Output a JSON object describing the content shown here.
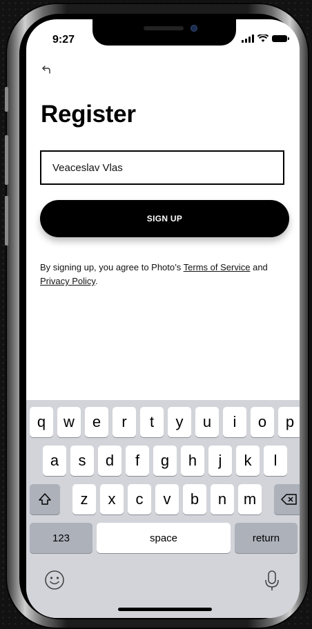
{
  "status_bar": {
    "time": "9:27"
  },
  "page": {
    "title": "Register"
  },
  "form": {
    "name_value": "Veaceslav Vlas",
    "signup_label": "SIGN UP",
    "terms_prefix": "By signing up, you agree to Photo’s ",
    "terms_link": "Terms of Service",
    "terms_middle": " and ",
    "privacy_link": "Privacy Policy",
    "terms_suffix": "."
  },
  "keyboard": {
    "row1": [
      "q",
      "w",
      "e",
      "r",
      "t",
      "y",
      "u",
      "i",
      "o",
      "p"
    ],
    "row2": [
      "a",
      "s",
      "d",
      "f",
      "g",
      "h",
      "j",
      "k",
      "l"
    ],
    "row3": [
      "z",
      "x",
      "c",
      "v",
      "b",
      "n",
      "m"
    ],
    "numbers_label": "123",
    "space_label": "space",
    "return_label": "return"
  },
  "icons": [
    "back-arrow-icon",
    "signal-icon",
    "wifi-icon",
    "battery-icon",
    "shift-icon",
    "backspace-icon",
    "emoji-icon",
    "microphone-icon"
  ]
}
